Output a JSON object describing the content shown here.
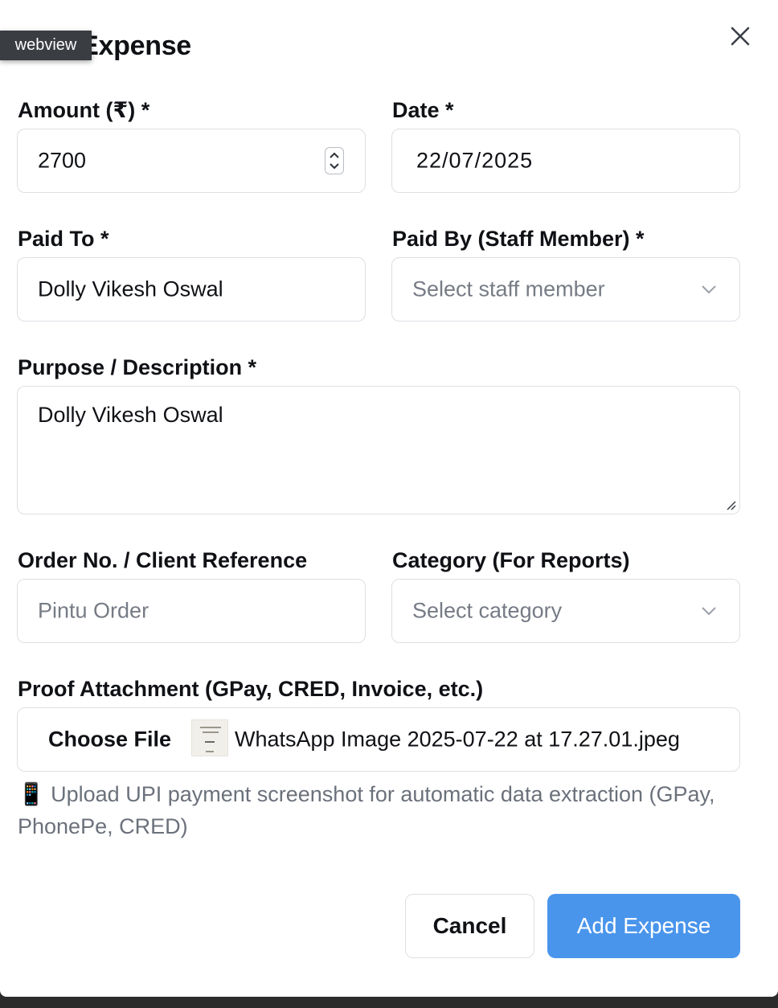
{
  "tooltip": "webview",
  "dialog": {
    "title": "New Expense",
    "close_icon": "close-icon"
  },
  "form": {
    "amount": {
      "label": "Amount (₹) *",
      "value": "2700"
    },
    "date": {
      "label": "Date *",
      "value": "22/07/2025"
    },
    "paid_to": {
      "label": "Paid To *",
      "value": "Dolly Vikesh Oswal"
    },
    "paid_by": {
      "label": "Paid By (Staff Member) *",
      "placeholder": "Select staff member"
    },
    "purpose": {
      "label": "Purpose / Description *",
      "value": "Dolly Vikesh Oswal"
    },
    "order_ref": {
      "label": "Order No. / Client Reference",
      "placeholder": "Pintu Order"
    },
    "category": {
      "label": "Category (For Reports)",
      "placeholder": "Select category"
    },
    "proof": {
      "label": "Proof Attachment (GPay, CRED, Invoice, etc.)",
      "choose_label": "Choose File",
      "file_name": "WhatsApp Image 2025-07-22 at 17.27.01.jpeg"
    },
    "hint": {
      "icon": "📱",
      "text": "Upload UPI payment screenshot for automatic data extraction (GPay, PhonePe, CRED)"
    }
  },
  "actions": {
    "cancel": "Cancel",
    "submit": "Add Expense"
  },
  "colors": {
    "primary": "#4a95ec",
    "border": "#dcdfe4",
    "placeholder": "#767b85"
  }
}
